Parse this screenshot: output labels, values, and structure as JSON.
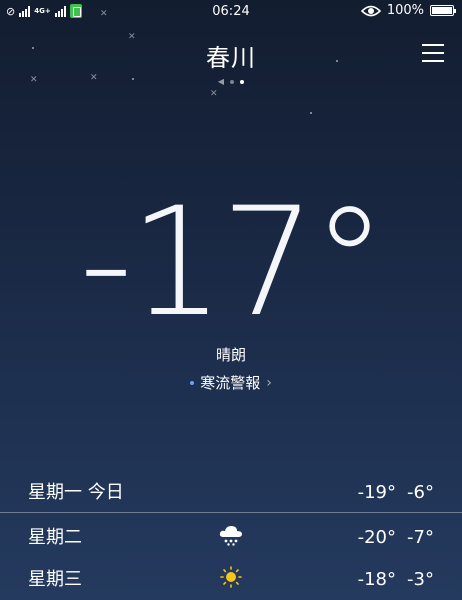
{
  "status_bar": {
    "time": "06:24",
    "network": "4G+",
    "battery": "100%",
    "battery_level": 1.0
  },
  "header": {
    "city": "春川",
    "page_indicator": {
      "count": 2,
      "active_index": 1
    }
  },
  "current": {
    "temperature": "-17°",
    "condition": "晴朗",
    "alert": "寒流警報"
  },
  "forecast": [
    {
      "day": "星期一 今日",
      "low": "-19°",
      "high": "-6°",
      "icon": "none"
    },
    {
      "day": "星期二",
      "low": "-20°",
      "high": "-7°",
      "icon": "snow-cloud-icon"
    },
    {
      "day": "星期三",
      "low": "-18°",
      "high": "-3°",
      "icon": "sun-icon"
    }
  ],
  "colors": {
    "sun": "#f5c518",
    "alert_dot": "#6aa0ff",
    "app_badge": "#3ec24b"
  }
}
